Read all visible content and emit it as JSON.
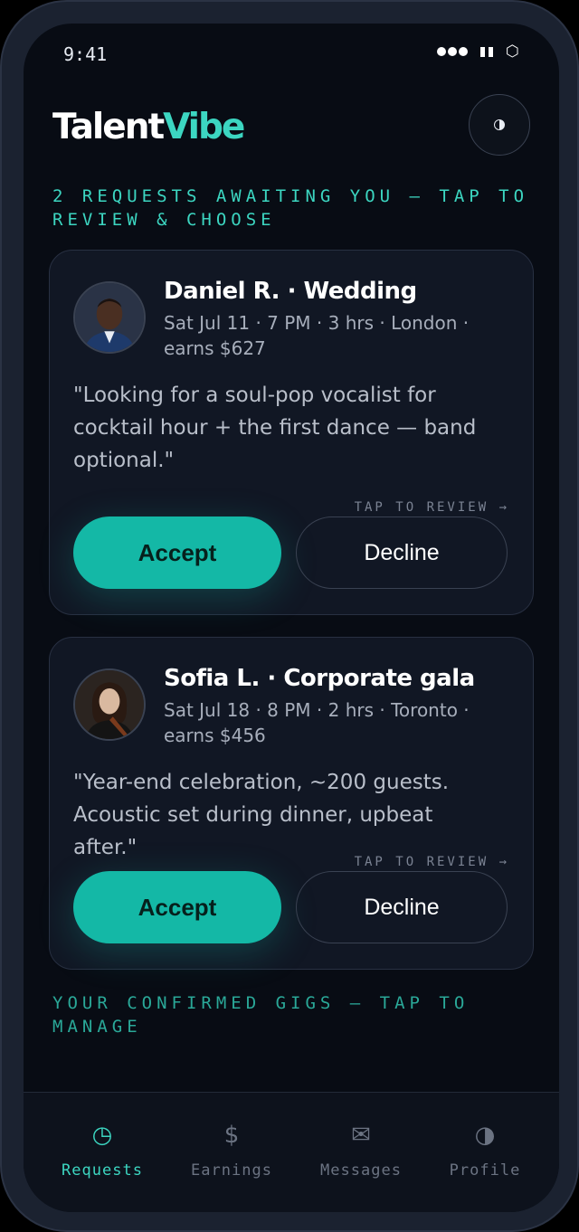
{
  "status_bar": {
    "time": "9:41"
  },
  "app": {
    "brand_part1": "Talent",
    "brand_part2": "Vibe",
    "accent_color": "#3cd6c1"
  },
  "requests_heading": "2 REQUESTS AWAITING YOU — TAP TO REVIEW & CHOOSE",
  "requests": [
    {
      "title": "Daniel R. · Wedding",
      "meta": "Sat Jul 11 · 7 PM · 3 hrs · London · earns $627",
      "quote": "\"Looking for a soul-pop vocalist for cocktail hour + the first dance — band optional.\"",
      "tap_hint": "TAP TO REVIEW →",
      "accept_label": "Accept",
      "decline_label": "Decline"
    },
    {
      "title": "Sofia L. · Corporate gala",
      "meta": "Sat Jul 18 · 8 PM · 2 hrs · Toronto · earns $456",
      "quote": "\"Year-end celebration, ~200 guests. Acoustic set during dinner, upbeat after.\"",
      "tap_hint": "TAP TO REVIEW →",
      "accept_label": "Accept",
      "decline_label": "Decline"
    }
  ],
  "confirmed_heading": "YOUR CONFIRMED GIGS — TAP TO MANAGE",
  "nav": [
    {
      "label": "Requests",
      "icon": "clock-icon",
      "glyph": "◷",
      "active": true
    },
    {
      "label": "Earnings",
      "icon": "dollar-icon",
      "glyph": "$",
      "active": false
    },
    {
      "label": "Messages",
      "icon": "envelope-icon",
      "glyph": "✉",
      "active": false
    },
    {
      "label": "Profile",
      "icon": "half-circle-icon",
      "glyph": "◑",
      "active": false
    }
  ]
}
